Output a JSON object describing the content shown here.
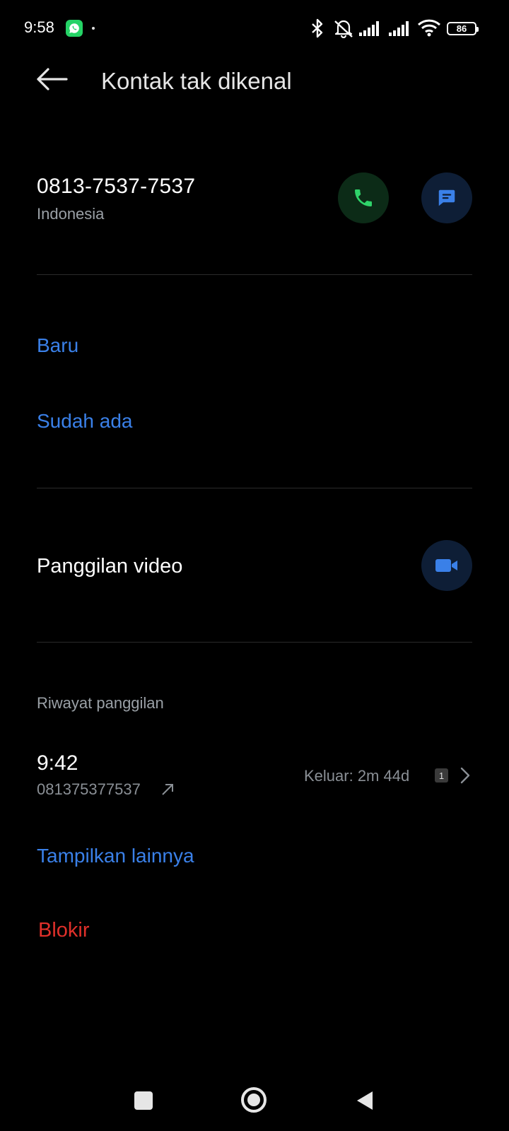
{
  "status_bar": {
    "time": "9:58",
    "battery": "86",
    "icons": [
      "whatsapp-icon",
      "bluetooth-icon",
      "mute-icon",
      "signal-icon",
      "signal-icon",
      "wifi-icon",
      "battery-icon"
    ]
  },
  "header": {
    "title": "Kontak tak dikenal",
    "back_icon": "arrow-left-icon"
  },
  "contact": {
    "number": "0813-7537-7537",
    "region": "Indonesia",
    "call_icon": "phone-icon",
    "message_icon": "message-icon"
  },
  "add_contact": {
    "new_label": "Baru",
    "existing_label": "Sudah ada"
  },
  "video_call": {
    "label": "Panggilan video",
    "icon": "video-camera-icon"
  },
  "call_history": {
    "section_title": "Riwayat panggilan",
    "entries": [
      {
        "time": "9:42",
        "number": "081375377537",
        "status": "Keluar: 2m 44d",
        "sim": "1"
      }
    ],
    "show_more_label": "Tampilkan lainnya"
  },
  "block_label": "Blokir",
  "colors": {
    "accent_blue": "#3a80e8",
    "danger_red": "#e0302a",
    "call_green": "#2fd36a",
    "background": "#000000"
  }
}
